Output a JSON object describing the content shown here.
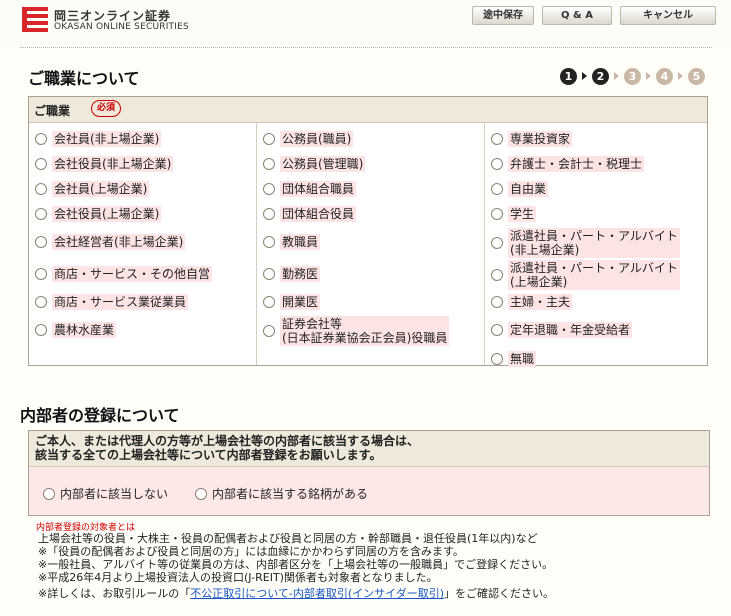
{
  "header": {
    "logo_jp": "岡三オンライン証券",
    "logo_en": "OKASAN ONLINE SECURITIES",
    "buttons": {
      "save": "途中保存",
      "qa": "Q & A",
      "cancel": "キャンセル"
    }
  },
  "occupation": {
    "title": "ご職業について",
    "steps": [
      "1",
      "2",
      "3",
      "4",
      "5"
    ],
    "current_step": 2,
    "field_label": "ご職業",
    "required_label": "必須",
    "columns": [
      [
        "会社員(非上場企業)",
        "会社役員(非上場企業)",
        "会社員(上場企業)",
        "会社役員(上場企業)",
        "会社経営者(非上場企業)",
        "商店・サービス・その他自営",
        "商店・サービス業従業員",
        "農林水産業"
      ],
      [
        "公務員(職員)",
        "公務員(管理職)",
        "団体組合職員",
        "団体組合役員",
        "教職員",
        "勤務医",
        "開業医",
        "証券会社等\n(日本証券業協会正会員)役職員"
      ],
      [
        "専業投資家",
        "弁護士・会計士・税理士",
        "自由業",
        "学生",
        "派遣社員・パート・アルバイト\n(非上場企業)",
        "派遣社員・パート・アルバイト\n(上場企業)",
        "主婦・主夫",
        "定年退職・年金受給者",
        "無職"
      ]
    ]
  },
  "insider": {
    "title": "内部者の登録について",
    "message_line1": "ご本人、または代理人の方等が上場会社等の内部者に該当する場合は、",
    "message_line2": "該当する全ての上場会社等について内部者登録をお願いします。",
    "option_no": "内部者に該当しない",
    "option_yes": "内部者に該当する銘柄がある"
  },
  "notes": {
    "title": "内部者登録の対象者とは",
    "lines": [
      "上場会社等の役員・大株主・役員の配偶者および役員と同居の方・幹部職員・退任役員(1年以内)など",
      "※「役員の配偶者および役員と同居の方」には血縁にかかわらず同居の方を含みます。",
      "※一般社員、アルバイト等の従業員の方は、内部者区分を「上場会社等の一般職員」でご登録ください。",
      "※平成26年4月より上場投資法人の投資口(J-REIT)関係者も対象者となりました。"
    ],
    "last_prefix": "※詳しくは、お取引ルールの「",
    "link_text": "不公正取引について-内部者取引(インサイダー取引)",
    "last_suffix": "」をご確認ください。"
  }
}
